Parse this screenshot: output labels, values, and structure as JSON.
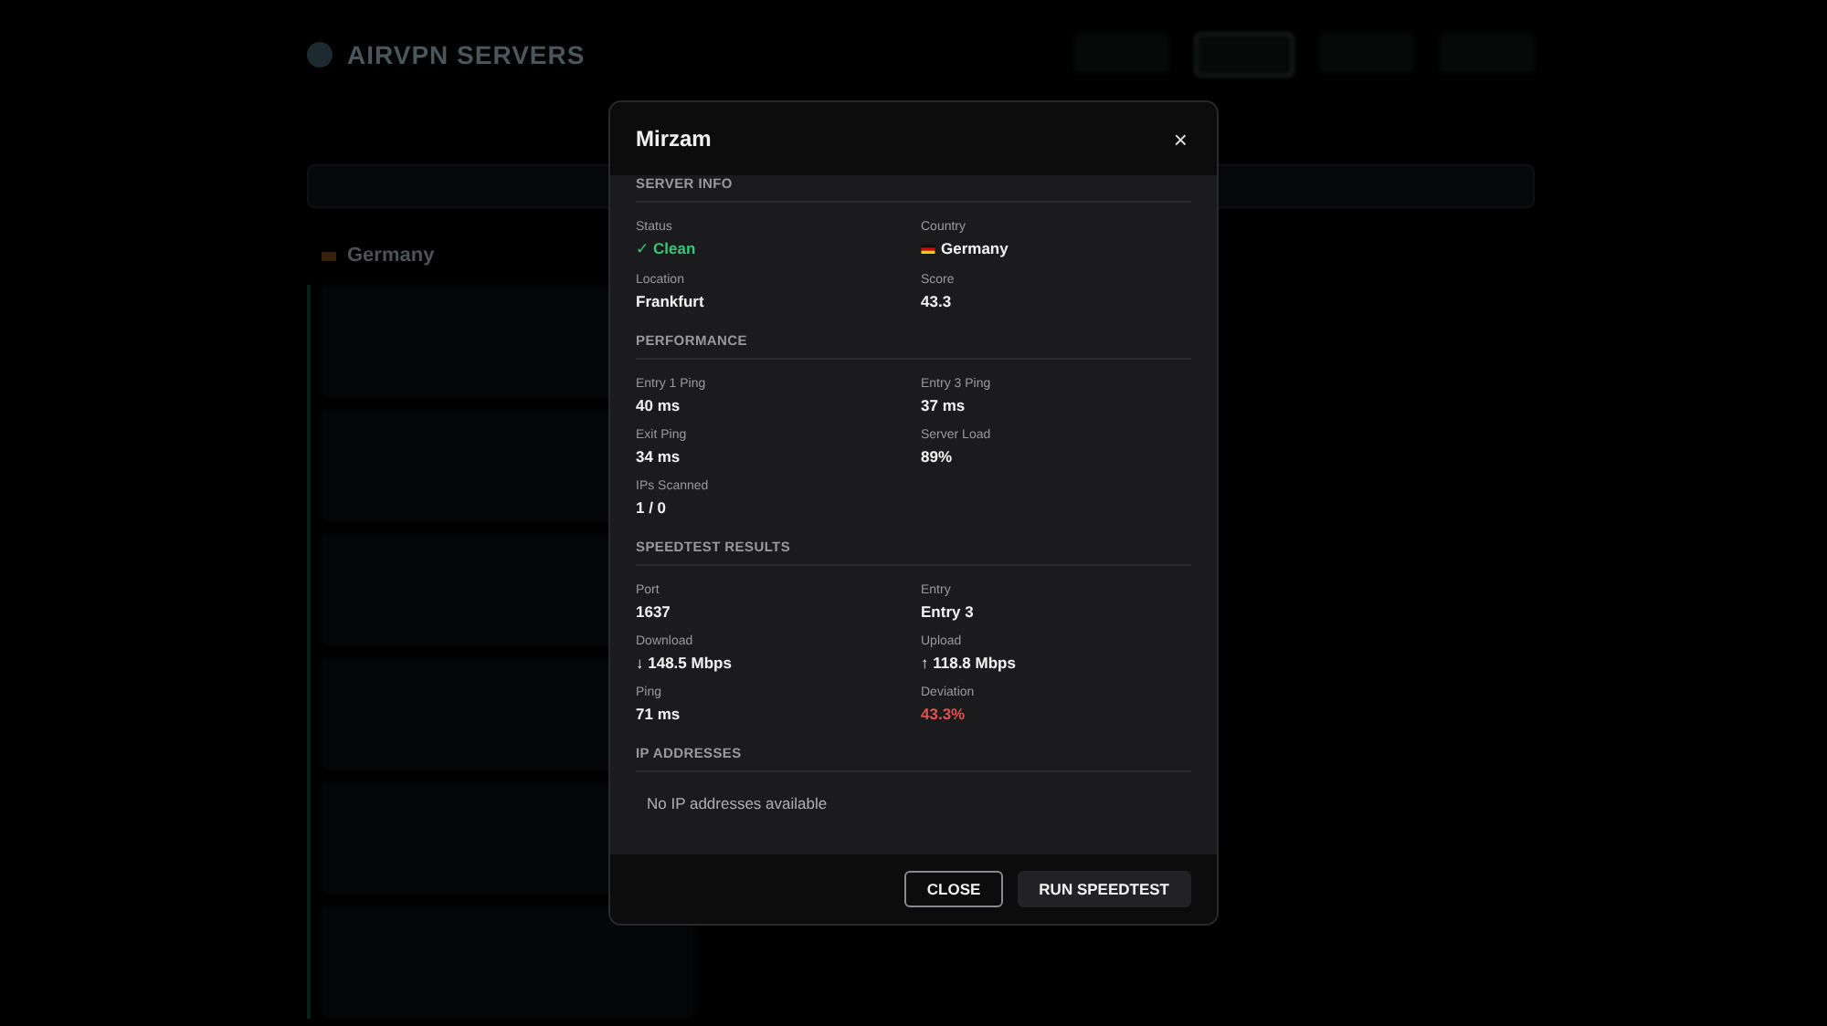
{
  "app": {
    "title": "AIRVPN SERVERS",
    "nav": [
      {
        "selected": false
      },
      {
        "selected": true
      },
      {
        "selected": false
      },
      {
        "selected": false
      }
    ],
    "group": "Germany"
  },
  "dialog": {
    "title": "Mirzam",
    "close": "×",
    "sections": [
      {
        "heading": "SERVER INFO",
        "fields": [
          {
            "label": "Status",
            "value": "✓ Clean",
            "color": "#34c77b",
            "kind": "text"
          },
          {
            "label": "Country",
            "value": "Germany",
            "kind": "flag"
          },
          {
            "label": "Location",
            "value": "Frankfurt",
            "kind": "text"
          },
          {
            "label": "Score",
            "value": "43.3",
            "kind": "text"
          }
        ]
      },
      {
        "heading": "PERFORMANCE",
        "fields": [
          {
            "label": "Entry 1 Ping",
            "value": "40 ms",
            "kind": "text"
          },
          {
            "label": "Entry 3 Ping",
            "value": "37 ms",
            "kind": "text"
          },
          {
            "label": "Exit Ping",
            "value": "34 ms",
            "kind": "text"
          },
          {
            "label": "Server Load",
            "value": "89%",
            "kind": "text"
          },
          {
            "label": "IPs Scanned",
            "value": "1 / 0",
            "kind": "text"
          }
        ]
      },
      {
        "heading": "SPEEDTEST RESULTS",
        "fields": [
          {
            "label": "Port",
            "value": "1637",
            "kind": "text"
          },
          {
            "label": "Entry",
            "value": "Entry 3",
            "kind": "text"
          },
          {
            "label": "Download",
            "value": "↓ 148.5 Mbps",
            "kind": "text"
          },
          {
            "label": "Upload",
            "value": "↑ 118.8 Mbps",
            "kind": "text"
          },
          {
            "label": "Ping",
            "value": "71 ms",
            "kind": "text"
          },
          {
            "label": "Deviation",
            "value": "43.3%",
            "color": "#e05252",
            "kind": "text"
          }
        ]
      },
      {
        "heading": "IP ADDRESSES",
        "empty": "No IP addresses available"
      }
    ],
    "buttons": [
      {
        "label": "CLOSE",
        "kind": "outline"
      },
      {
        "label": "RUN SPEEDTEST",
        "kind": "filled"
      }
    ]
  }
}
